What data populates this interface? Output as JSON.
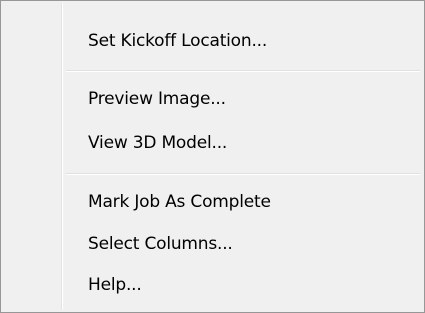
{
  "menu": {
    "items": [
      {
        "label": "Set Kickoff Location..."
      },
      {
        "label": "Preview Image..."
      },
      {
        "label": "View 3D Model..."
      },
      {
        "label": "Mark Job As Complete"
      },
      {
        "label": "Select Columns..."
      },
      {
        "label": "Help..."
      }
    ]
  },
  "colors": {
    "background": "#f0f0f0",
    "border": "#979797",
    "separator": "#e0e0e0",
    "text": "#000000"
  }
}
